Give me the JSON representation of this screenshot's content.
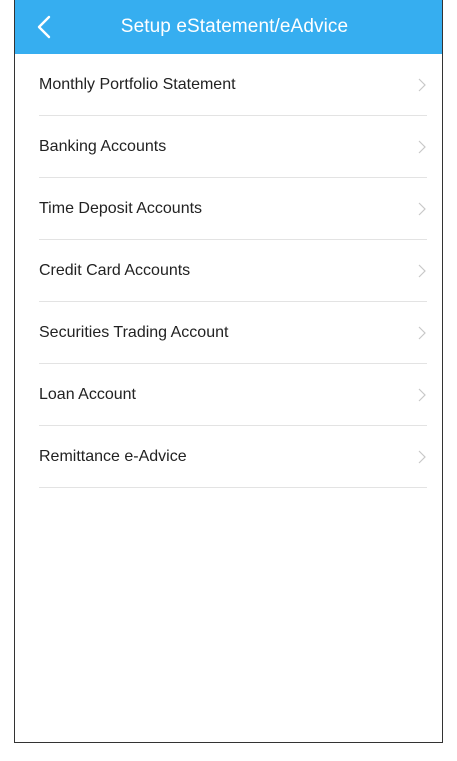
{
  "header": {
    "title": "Setup eStatement/eAdvice",
    "background_color": "#36aef0",
    "back_icon": "chevron-left-icon"
  },
  "menu": {
    "items": [
      {
        "label": "Monthly Portfolio Statement",
        "icon": "chevron-right-icon"
      },
      {
        "label": "Banking Accounts",
        "icon": "chevron-right-icon"
      },
      {
        "label": "Time Deposit Accounts",
        "icon": "chevron-right-icon"
      },
      {
        "label": "Credit Card Accounts",
        "icon": "chevron-right-icon"
      },
      {
        "label": "Securities Trading Account",
        "icon": "chevron-right-icon"
      },
      {
        "label": "Loan Account",
        "icon": "chevron-right-icon"
      },
      {
        "label": "Remittance e-Advice",
        "icon": "chevron-right-icon"
      }
    ]
  }
}
